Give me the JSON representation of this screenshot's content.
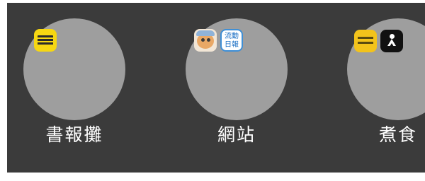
{
  "folders": [
    {
      "label": "書報攤",
      "apps": [
        {
          "icon": "yellow-newspaper-app-icon",
          "color": "#f6d712"
        }
      ]
    },
    {
      "label": "網站",
      "apps": [
        {
          "icon": "cartoon-character-app-icon",
          "color": "#e9a866"
        },
        {
          "icon": "blue-text-app-icon",
          "text": "流動\n日報",
          "color": "#1b6fc4"
        }
      ]
    },
    {
      "label": "煮食",
      "apps": [
        {
          "icon": "yellow-label-app-icon",
          "color": "#f3c31b"
        },
        {
          "icon": "chef-figure-app-icon",
          "color": "#111111"
        }
      ]
    }
  ],
  "colors": {
    "background": "#3b3b3b",
    "folder": "#9e9e9e",
    "label": "#ffffff"
  }
}
